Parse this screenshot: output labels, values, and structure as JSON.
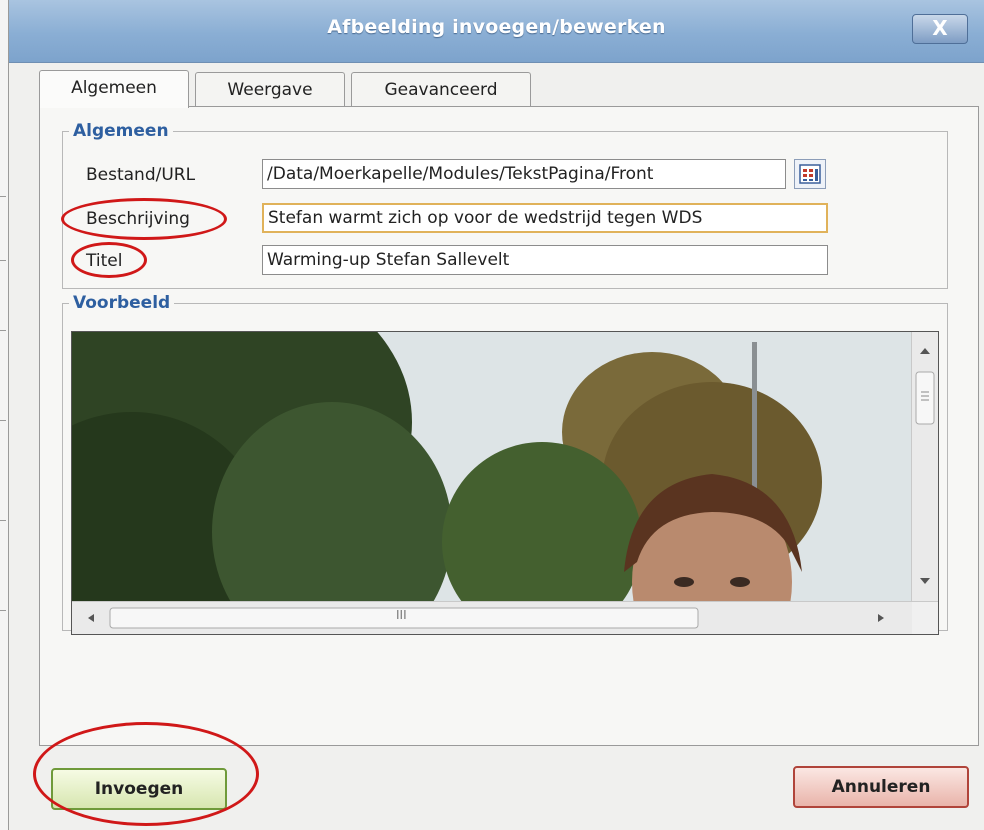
{
  "dialog": {
    "title": "Afbeelding invoegen/bewerken",
    "close_label": "X"
  },
  "tabs": [
    {
      "label": "Algemeen",
      "active": true
    },
    {
      "label": "Weergave",
      "active": false
    },
    {
      "label": "Geavanceerd",
      "active": false
    }
  ],
  "general": {
    "legend": "Algemeen",
    "fields": {
      "file_label": "Bestand/URL",
      "file_value": "/Data/Moerkapelle/Modules/TekstPagina/Front",
      "description_label": "Beschrijving",
      "description_value": "Stefan warmt zich op voor de wedstrijd tegen WDS",
      "title_label": "Titel",
      "title_value": "Warming-up Stefan Sallevelt"
    }
  },
  "preview": {
    "legend": "Voorbeeld",
    "hscroll_grip": "III"
  },
  "buttons": {
    "insert": "Invoegen",
    "cancel": "Annuleren"
  },
  "icons": {
    "browse": "browse-grid-icon",
    "close": "close-icon"
  },
  "colors": {
    "legend": "#2e5fa0",
    "titlebar": "#8aaed4",
    "annotation": "#d01818",
    "focus_border": "#e0b25a"
  }
}
